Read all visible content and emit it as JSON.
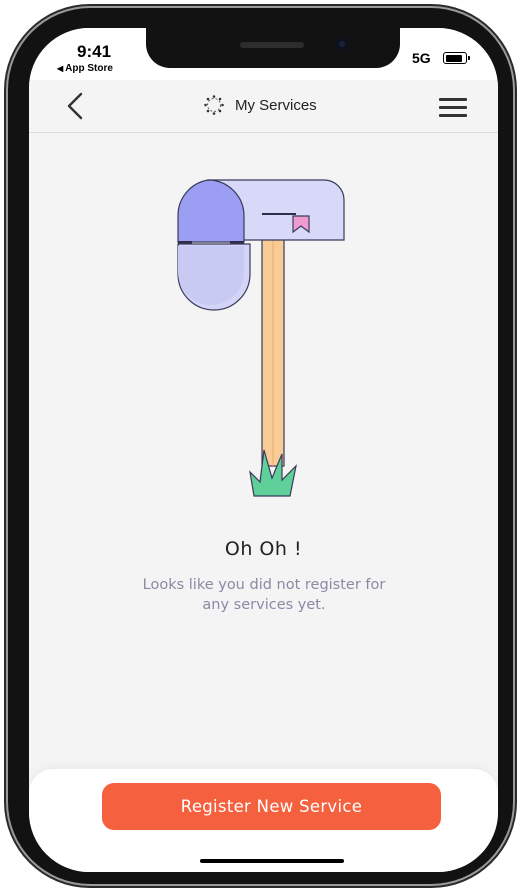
{
  "status_bar": {
    "time": "9:41",
    "back_app": "App Store",
    "network": "5G"
  },
  "nav": {
    "title": "My Services",
    "title_icon": "spinner-icon",
    "back_icon": "chevron-left-icon",
    "menu_icon": "hamburger-icon"
  },
  "empty_state": {
    "title": "Oh Oh !",
    "message_line1": "Looks like you did not register for",
    "message_line2": "any services yet.",
    "illustration": "mailbox-illustration"
  },
  "footer": {
    "register_label": "Register New Service"
  },
  "colors": {
    "accent": "#f5603f",
    "background": "#f4f4f4",
    "mailbox_dark": "#9b9ef2",
    "mailbox_light": "#d8d9f8",
    "post": "#f9cb96",
    "grass": "#5fd09a",
    "flag": "#f09ad2",
    "muted_text": "#8a8aa6"
  }
}
